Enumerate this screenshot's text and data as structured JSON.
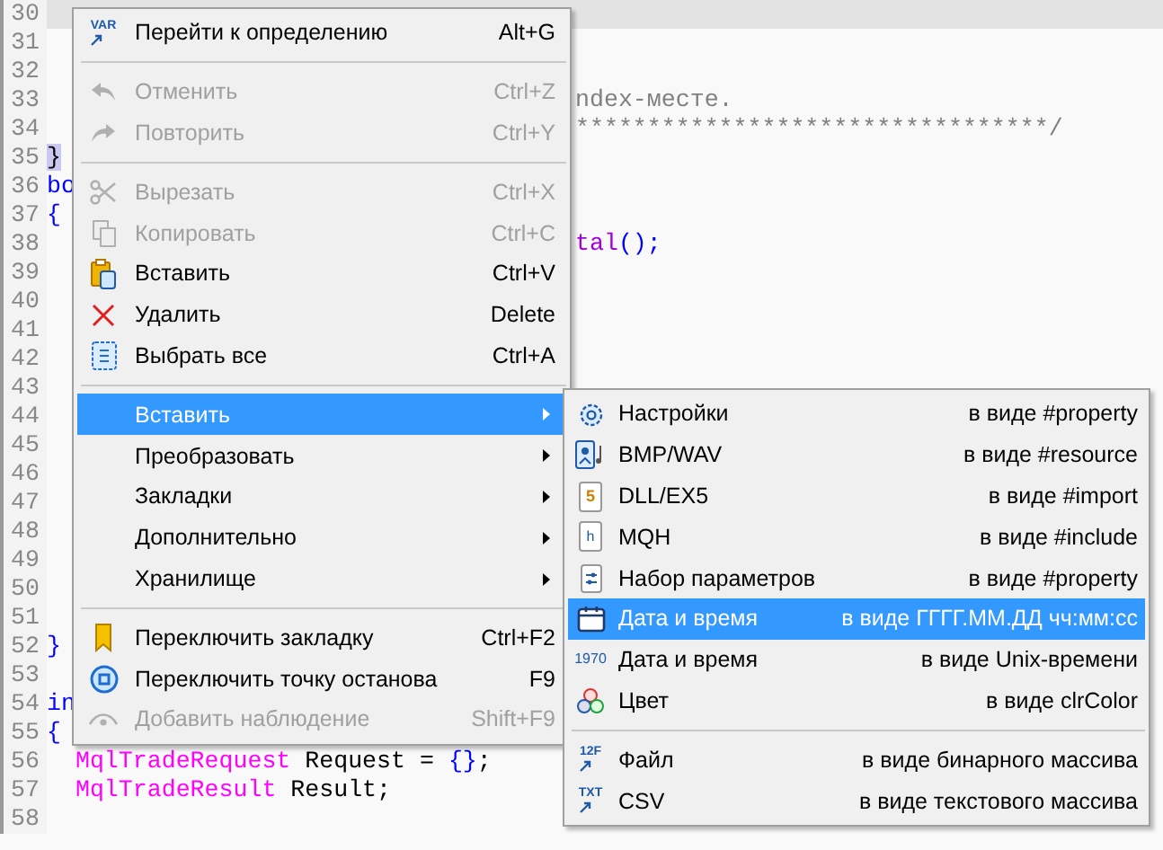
{
  "editor": {
    "lines": [
      {
        "number": "30"
      },
      {
        "number": "31"
      },
      {
        "number": "32"
      },
      {
        "number": "33",
        "tail": [
          {
            "kind": "comment",
            "text": "ndex-месте."
          }
        ]
      },
      {
        "number": "34",
        "tail": [
          {
            "kind": "comment",
            "text": "*********************************/"
          }
        ]
      },
      {
        "number": "35",
        "code": [
          {
            "kind": "match",
            "text": "}"
          }
        ]
      },
      {
        "number": "36",
        "code": [
          {
            "kind": "keyword",
            "text": "bo"
          }
        ]
      },
      {
        "number": "37",
        "code": [
          {
            "kind": "punct",
            "text": "{"
          }
        ]
      },
      {
        "number": "38",
        "tail": [
          {
            "kind": "func",
            "text": "tal"
          },
          {
            "kind": "punct",
            "text": "();"
          }
        ]
      },
      {
        "number": "39"
      },
      {
        "number": "40"
      },
      {
        "number": "41"
      },
      {
        "number": "42"
      },
      {
        "number": "43"
      },
      {
        "number": "44"
      },
      {
        "number": "45"
      },
      {
        "number": "46"
      },
      {
        "number": "47"
      },
      {
        "number": "48"
      },
      {
        "number": "49"
      },
      {
        "number": "50"
      },
      {
        "number": "51"
      },
      {
        "number": "52",
        "code": [
          {
            "kind": "punct",
            "text": "}"
          }
        ]
      },
      {
        "number": "53"
      },
      {
        "number": "54",
        "code": [
          {
            "kind": "keyword",
            "text": "in"
          }
        ]
      },
      {
        "number": "55",
        "code": [
          {
            "kind": "punct",
            "text": "{"
          }
        ]
      },
      {
        "number": "56",
        "code": [
          {
            "kind": "type",
            "text": "  MqlTradeRequest"
          },
          {
            "kind": "plain",
            "text": " Request = "
          },
          {
            "kind": "punct",
            "text": "{}"
          },
          {
            "kind": "plain",
            "text": ";"
          }
        ]
      },
      {
        "number": "57",
        "code": [
          {
            "kind": "type",
            "text": "  MqlTradeResult"
          },
          {
            "kind": "plain",
            "text": " Result;"
          }
        ]
      },
      {
        "number": "58"
      }
    ]
  },
  "context_menu": {
    "groups": [
      [
        {
          "label": "Перейти к определению",
          "icon_text": "VAR",
          "shortcut": "Alt+G",
          "disabled": false,
          "selected": false,
          "submenu": false
        }
      ],
      [
        {
          "label": "Отменить",
          "shortcut": "Ctrl+Z",
          "disabled": true,
          "selected": false,
          "submenu": false
        },
        {
          "label": "Повторить",
          "shortcut": "Ctrl+Y",
          "disabled": true,
          "selected": false,
          "submenu": false
        }
      ],
      [
        {
          "label": "Вырезать",
          "shortcut": "Ctrl+X",
          "disabled": true,
          "selected": false,
          "submenu": false
        },
        {
          "label": "Копировать",
          "shortcut": "Ctrl+C",
          "disabled": true,
          "selected": false,
          "submenu": false
        },
        {
          "label": "Вставить",
          "shortcut": "Ctrl+V",
          "disabled": false,
          "selected": false,
          "submenu": false
        },
        {
          "label": "Удалить",
          "shortcut": "Delete",
          "disabled": false,
          "selected": false,
          "submenu": false
        },
        {
          "label": "Выбрать все",
          "shortcut": "Ctrl+A",
          "disabled": false,
          "selected": false,
          "submenu": false
        }
      ],
      [
        {
          "label": "Вставить",
          "disabled": false,
          "selected": true,
          "submenu": true
        },
        {
          "label": "Преобразовать",
          "disabled": false,
          "selected": false,
          "submenu": true
        },
        {
          "label": "Закладки",
          "disabled": false,
          "selected": false,
          "submenu": true
        },
        {
          "label": "Дополнительно",
          "disabled": false,
          "selected": false,
          "submenu": true
        },
        {
          "label": "Хранилище",
          "disabled": false,
          "selected": false,
          "submenu": true
        }
      ],
      [
        {
          "label": "Переключить закладку",
          "shortcut": "Ctrl+F2",
          "disabled": false,
          "selected": false,
          "submenu": false
        },
        {
          "label": "Переключить точку останова",
          "shortcut": "F9",
          "disabled": false,
          "selected": false,
          "submenu": false
        },
        {
          "label": "Добавить наблюдение",
          "shortcut": "Shift+F9",
          "disabled": true,
          "selected": false,
          "submenu": false
        }
      ]
    ]
  },
  "insert_submenu": {
    "groups": [
      [
        {
          "label": "Настройки",
          "format": "в виде #property",
          "selected": false
        },
        {
          "label": "BMP/WAV",
          "format": "в виде #resource",
          "selected": false
        },
        {
          "label": "DLL/EX5",
          "icon_text": "5",
          "format": "в виде #import",
          "selected": false
        },
        {
          "label": "MQH",
          "icon_text": "h",
          "format": "в виде #include",
          "selected": false
        },
        {
          "label": "Набор параметров",
          "format": "в виде #property",
          "selected": false
        },
        {
          "label": "Дата и время",
          "format": "в виде ГГГГ.ММ.ДД чч:мм:сс",
          "selected": true
        },
        {
          "label": "Дата и время",
          "icon_text": "1970",
          "format": "в виде Unix-времени",
          "selected": false
        },
        {
          "label": "Цвет",
          "format": "в виде clrColor",
          "selected": false
        }
      ],
      [
        {
          "label": "Файл",
          "icon_text": "12F",
          "format": "в виде бинарного массива",
          "selected": false
        },
        {
          "label": "CSV",
          "icon_text": "TXT",
          "format": "в виде текстового массива",
          "selected": false
        }
      ]
    ]
  }
}
